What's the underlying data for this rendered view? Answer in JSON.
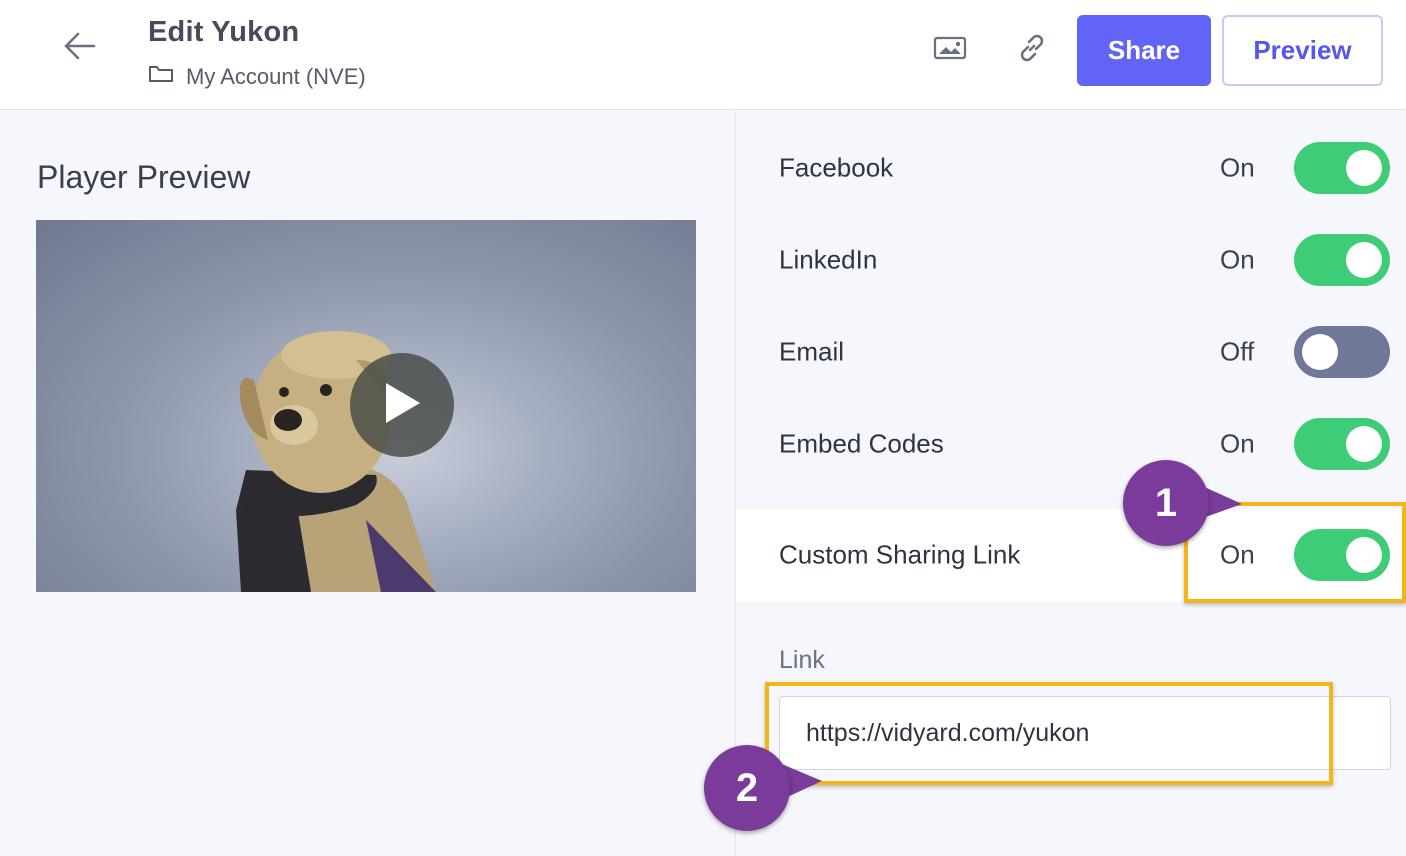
{
  "header": {
    "title": "Edit Yukon",
    "breadcrumb": "My Account (NVE)",
    "share_label": "Share",
    "preview_label": "Preview",
    "icons": {
      "back": "arrow-left-icon",
      "folder": "folder-icon",
      "thumbnail": "image-icon",
      "link": "link-icon"
    }
  },
  "player": {
    "title": "Player Preview",
    "play_icon": "play-icon"
  },
  "sharing": {
    "items": [
      {
        "label": "Facebook",
        "status": "On",
        "enabled": true
      },
      {
        "label": "LinkedIn",
        "status": "On",
        "enabled": true
      },
      {
        "label": "Email",
        "status": "Off",
        "enabled": false
      },
      {
        "label": "Embed Codes",
        "status": "On",
        "enabled": true
      },
      {
        "label": "Custom Sharing Link",
        "status": "On",
        "enabled": true
      }
    ],
    "link_label": "Link",
    "link_value": "https://vidyard.com/yukon"
  },
  "annotations": {
    "callout_1": "1",
    "callout_2": "2"
  },
  "colors": {
    "accent": "#6264f5",
    "toggle_on": "#3fcc76",
    "toggle_off": "#6f7896",
    "highlight": "#f3b51a",
    "callout": "#7b3b9a"
  }
}
